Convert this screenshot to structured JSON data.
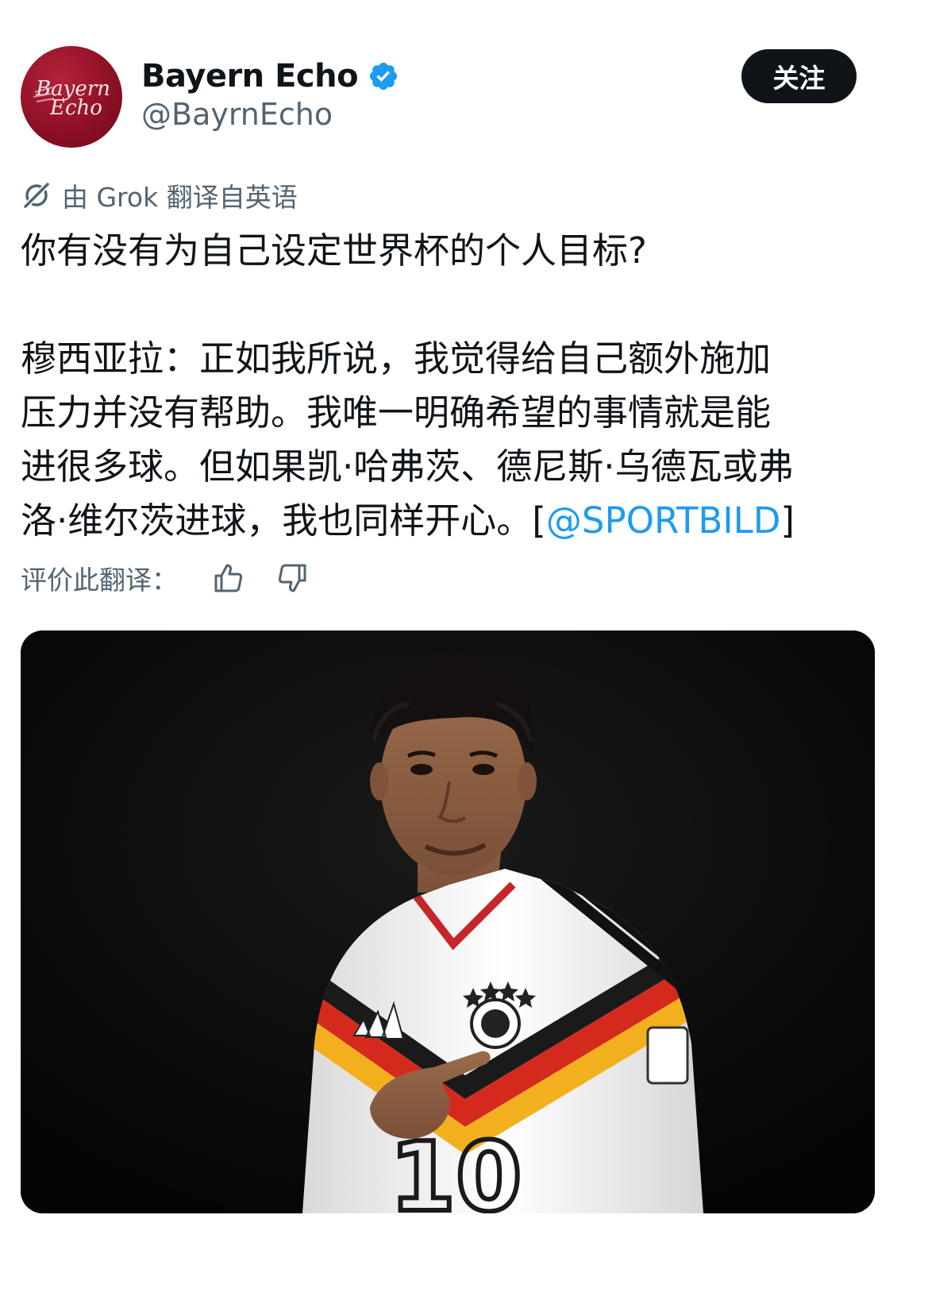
{
  "colors": {
    "text_primary": "#0f1419",
    "text_secondary": "#536471",
    "link": "#1d9bf0",
    "verified": "#1d9bf0",
    "follow_button_bg": "#0f1419",
    "avatar_bg": "#8f1024"
  },
  "author": {
    "avatar_alt": "Bayern Echo",
    "avatar_line1": "Bayern",
    "avatar_line2": "Echo",
    "display_name": "Bayern Echo",
    "handle": "@BayrnEcho",
    "verified_icon": "verified-badge-icon"
  },
  "follow_button": {
    "label": "关注"
  },
  "translation": {
    "icon": "grok-icon",
    "label": "由 Grok 翻译自英语"
  },
  "tweet": {
    "line1": "你有没有为自己设定世界杯的个人目标?",
    "line2": "穆西亚拉：正如我所说，我觉得给自己额外施加",
    "line3": "压力并没有帮助。我唯一明确希望的事情就是能",
    "line4": "进很多球。但如果凯·哈弗茨、德尼斯·乌德瓦或弗",
    "line5_prefix": "洛·维尔茨进球，我也同样开心。[",
    "mention": "@SPORTBILD",
    "line5_suffix": "]"
  },
  "rating": {
    "label": "评价此翻译：",
    "thumbs_up_icon": "thumbs-up-icon",
    "thumbs_down_icon": "thumbs-down-icon"
  },
  "media": {
    "alt": "Player in white Germany jersey number 10 pointing at the crest, dark background",
    "jersey_number": "10"
  }
}
